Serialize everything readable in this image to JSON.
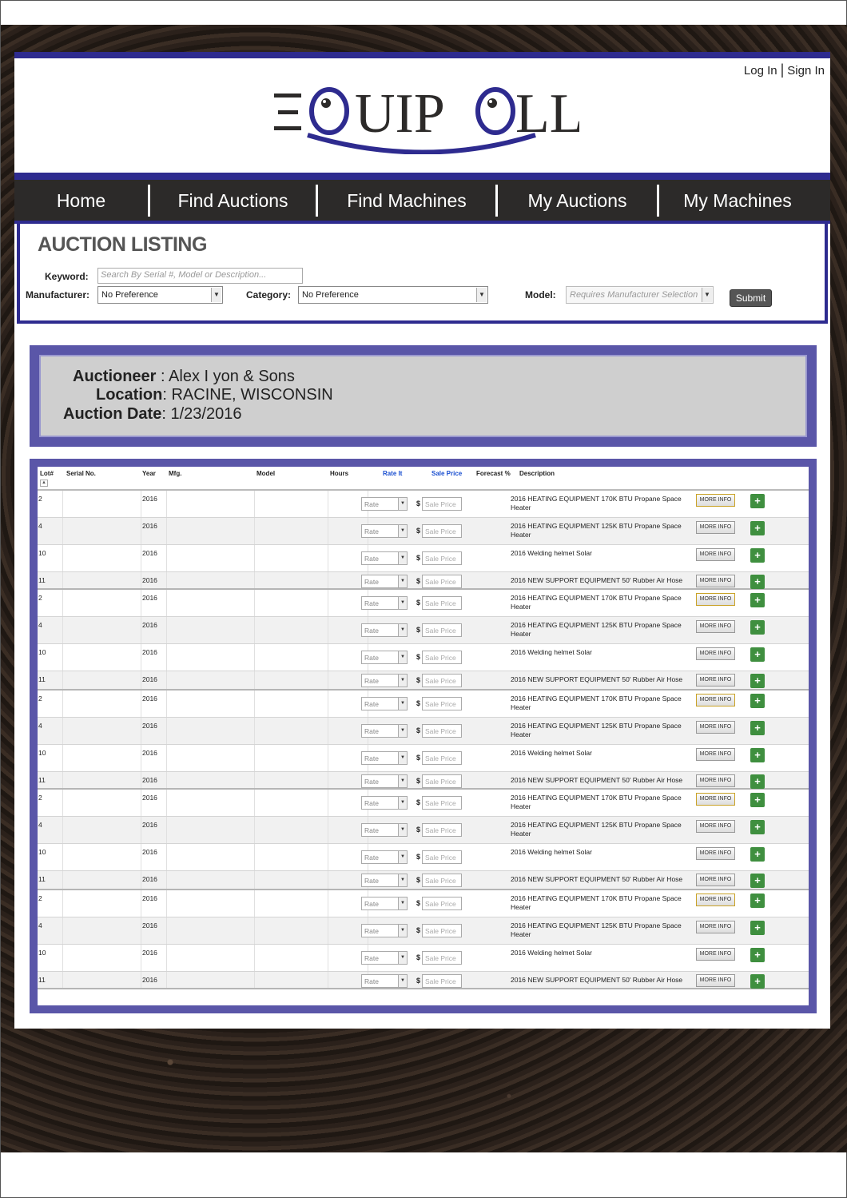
{
  "header": {
    "login": "Log In",
    "signin": "Sign In",
    "brand": "EQUIPOLL"
  },
  "nav": [
    "Home",
    "Find Auctions",
    "Find Machines",
    "My Auctions",
    "My Machines"
  ],
  "search": {
    "title": "AUCTION LISTING",
    "keyword_label": "Keyword:",
    "keyword_placeholder": "Search By Serial #, Model or Description...",
    "manufacturer_label": "Manufacturer:",
    "manufacturer_value": "No Preference",
    "category_label": "Category:",
    "category_value": "No Preference",
    "model_label": "Model:",
    "model_value": "Requires Manufacturer Selection",
    "submit": "Submit"
  },
  "auction": {
    "auctioneer_label": "Auctioneer",
    "auctioneer": "Alex I yon & Sons",
    "location_label": "Location",
    "location": "RACINE, WISCONSIN",
    "date_label": "Auction Date",
    "date": "1/23/2016"
  },
  "table": {
    "headers": {
      "lot": "Lot#",
      "serial": "Serial No.",
      "year": "Year",
      "mfg": "Mfg.",
      "model": "Model",
      "hours": "Hours",
      "rate": "Rate It",
      "sale": "Sale Price",
      "forecast": "Forecast %",
      "description": "Description"
    },
    "sort_icon": "sort-up-icon",
    "rate_placeholder": "Rate",
    "sale_placeholder": "Sale Price",
    "dollar": "$",
    "more_label": "MORE INFO",
    "plus_label": "+",
    "rows": [
      {
        "lot": "2",
        "year": "2016",
        "desc": "2016 HEATING EQUIPMENT 170K BTU Propane Space Heater"
      },
      {
        "lot": "4",
        "year": "2016",
        "desc": "2016 HEATING EQUIPMENT 125K BTU Propane Space Heater"
      },
      {
        "lot": "10",
        "year": "2016",
        "desc": "2016 Welding helmet Solar"
      },
      {
        "lot": "11",
        "year": "2016",
        "desc": "2016 NEW SUPPORT EQUIPMENT 50' Rubber Air Hose"
      },
      {
        "lot": "2",
        "year": "2016",
        "desc": "2016 HEATING EQUIPMENT 170K BTU Propane Space Heater"
      },
      {
        "lot": "4",
        "year": "2016",
        "desc": "2016 HEATING EQUIPMENT 125K BTU Propane Space Heater"
      },
      {
        "lot": "10",
        "year": "2016",
        "desc": "2016 Welding helmet Solar"
      },
      {
        "lot": "11",
        "year": "2016",
        "desc": "2016 NEW SUPPORT EQUIPMENT 50' Rubber Air Hose"
      },
      {
        "lot": "2",
        "year": "2016",
        "desc": "2016 HEATING EQUIPMENT 170K BTU Propane Space Heater"
      },
      {
        "lot": "4",
        "year": "2016",
        "desc": "2016 HEATING EQUIPMENT 125K BTU Propane Space Heater"
      },
      {
        "lot": "10",
        "year": "2016",
        "desc": "2016 Welding helmet Solar"
      },
      {
        "lot": "11",
        "year": "2016",
        "desc": "2016 NEW SUPPORT EQUIPMENT 50' Rubber Air Hose"
      },
      {
        "lot": "2",
        "year": "2016",
        "desc": "2016 HEATING EQUIPMENT 170K BTU Propane Space Heater"
      },
      {
        "lot": "4",
        "year": "2016",
        "desc": "2016 HEATING EQUIPMENT 125K BTU Propane Space Heater"
      },
      {
        "lot": "10",
        "year": "2016",
        "desc": "2016 Welding helmet Solar"
      },
      {
        "lot": "11",
        "year": "2016",
        "desc": "2016 NEW SUPPORT EQUIPMENT 50' Rubber Air Hose"
      },
      {
        "lot": "2",
        "year": "2016",
        "desc": "2016 HEATING EQUIPMENT 170K BTU Propane Space Heater"
      },
      {
        "lot": "4",
        "year": "2016",
        "desc": "2016 HEATING EQUIPMENT 125K BTU Propane Space Heater"
      },
      {
        "lot": "10",
        "year": "2016",
        "desc": "2016 Welding helmet Solar"
      },
      {
        "lot": "11",
        "year": "2016",
        "desc": "2016 NEW SUPPORT EQUIPMENT 50' Rubber Air Hose"
      }
    ]
  },
  "colors": {
    "brand_blue": "#2e2b8f",
    "panel_purple": "#5a56a8",
    "nav_dark": "#2c2a29",
    "plus_green": "#3f8f3f"
  }
}
